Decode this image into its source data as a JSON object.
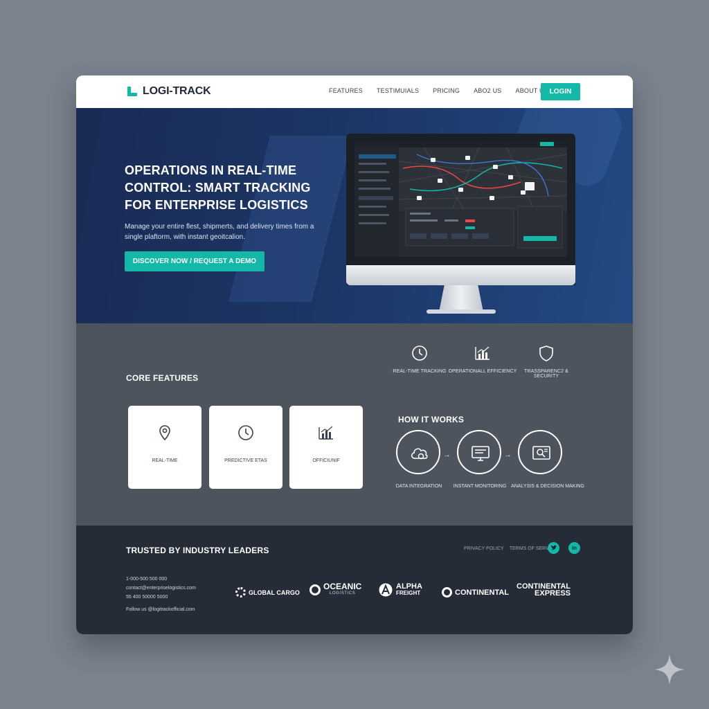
{
  "brand": {
    "name": "LOGI-TRACK",
    "accent": "#14b8a6",
    "hero_bg": "#1c3564"
  },
  "nav": {
    "links": [
      "FEATURES",
      "TESTIMUIALS",
      "PRICING",
      "ABO2 US",
      "ABOUT US"
    ],
    "login_label": "LOGIN"
  },
  "hero": {
    "title": "OPERATIONS IN REAL-TIME CONTROL: SMART TRACKING FOR ENTERPRISE LOGISTICS",
    "subtitle": "Manage your entire flest, shipmerts, and delivery times from a single plaftorm, with instant geoitcalion.",
    "cta_label": "DISCOVER NOW / REQUEST A DEMO"
  },
  "features": {
    "title": "CORE FEATURES",
    "top_items": [
      {
        "label": "REAL-TIME TRACKING",
        "icon": "clock-icon"
      },
      {
        "label": "OPERATIONALL EFFICIENCY",
        "icon": "bar-chart-icon"
      },
      {
        "label": "TRASSPARENC2 & SECURITY",
        "icon": "shield-icon"
      }
    ],
    "cards": [
      {
        "label": "REAL-TIME",
        "icon": "map-pin-icon"
      },
      {
        "label": "PREDICTIVE ETAS",
        "icon": "clock-icon"
      },
      {
        "label": "OFFICIUNIF",
        "icon": "bar-chart-icon"
      }
    ]
  },
  "how_it_works": {
    "title": "HOW IT WORKS",
    "steps": [
      {
        "label": "DATA INTEGRATION",
        "icon": "cloud-icon"
      },
      {
        "label": "INSTANT MONITORING",
        "icon": "monitor-icon"
      },
      {
        "label": "ANALYSIS & DECISION MAKING",
        "icon": "search-doc-icon"
      }
    ]
  },
  "footer": {
    "title": "TRUSTED BY INDUSTRY LEADERS",
    "links": [
      "PRIVACY POLICY",
      "TERMS OF SERVICE"
    ],
    "social": [
      "twitter-icon",
      "linkedin-icon"
    ],
    "contact": [
      "1-000-500 500 000",
      "contact@enterpriselogistics.com",
      "55 400 50000 5000",
      "Follow us @logitrackofficial.com"
    ],
    "partners": [
      {
        "line1": "GLOBAL CARGO",
        "line2": ""
      },
      {
        "line1": "OCEANIC",
        "line2": "LOGISTICS"
      },
      {
        "line1": "ALPHA",
        "line2": "FREIGHT"
      },
      {
        "line1": "CONTINENTAL",
        "line2": ""
      },
      {
        "line1": "CONTINENTAL",
        "line2": "EXPRESS"
      }
    ]
  }
}
